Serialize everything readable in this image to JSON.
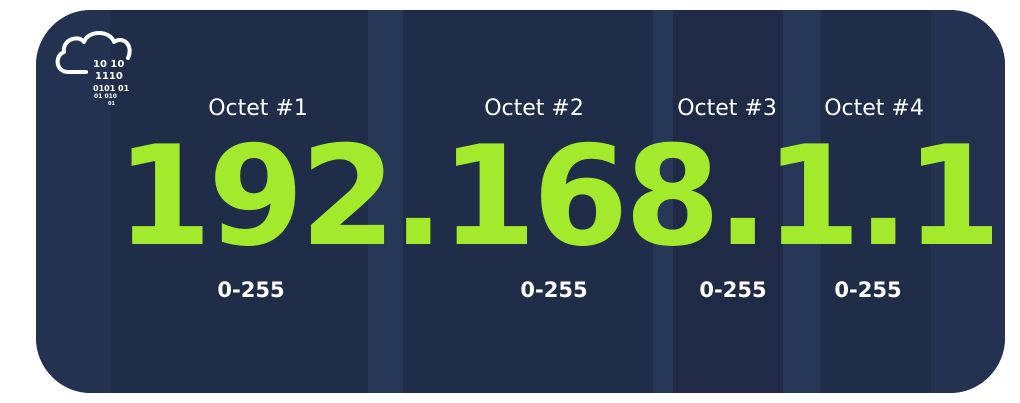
{
  "colors": {
    "background": "#233250",
    "band_dark": "#1f2d48",
    "band_light": "#263757",
    "accent": "#a4ea2c",
    "text": "#ffffff"
  },
  "logo": {
    "icon": "cloud-binary-icon",
    "bits": [
      "10  10",
      "1110",
      "0101  01",
      "01  010",
      "01"
    ]
  },
  "ip_address": {
    "octets": [
      "192",
      "168",
      "1",
      "1"
    ],
    "separator": "."
  },
  "octet_labels": [
    "Octet #1",
    "Octet #2",
    "Octet #3",
    "Octet #4"
  ],
  "ranges": [
    "0-255",
    "0-255",
    "0-255",
    "0-255"
  ]
}
